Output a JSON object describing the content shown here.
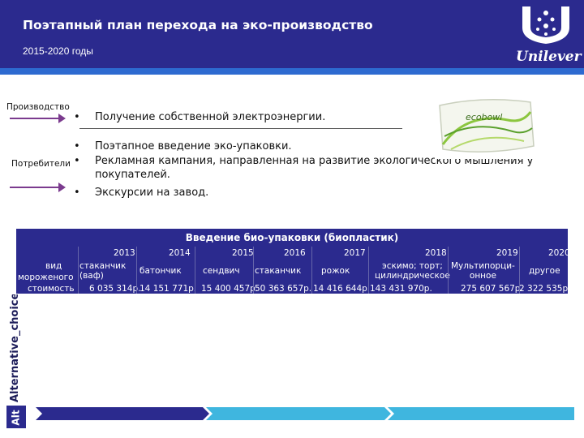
{
  "header": {
    "title": "Поэтапный план перехода на эко-производство",
    "subtitle": "2015-2020 годы",
    "logo_text": "Unilever"
  },
  "left": {
    "production_label": "Производство",
    "consumers_label": "Потребители"
  },
  "bullets": {
    "b1": "Получение собственной электроэнергии.",
    "b2": "Поэтапное введение эко-упаковки.",
    "b3a": "Рекламная кампания, направленная на развитие экологического мышления у",
    "b3b": "покупателей.",
    "b4": "Экскурсии на завод."
  },
  "package": {
    "brand": "ecobowl"
  },
  "table": {
    "title": "Введение био-упаковки (биопластик)",
    "row_labels": {
      "type_a": "вид",
      "type_b": "мороженого",
      "cost": "стоимость"
    },
    "years": [
      "2013",
      "2014",
      "2015",
      "2016",
      "2017",
      "2018",
      "2019",
      "2020"
    ],
    "types": [
      [
        "стаканчик",
        "(ваф)"
      ],
      [
        "батончик",
        ""
      ],
      [
        "сендвич",
        ""
      ],
      [
        "стаканчик",
        ""
      ],
      [
        "рожок",
        ""
      ],
      [
        "эскимо; торт;",
        "цилиндрическое"
      ],
      [
        "Мультипорци-",
        "онное"
      ],
      [
        "другое",
        ""
      ]
    ],
    "costs": [
      "6 035 314р.",
      "14 151 771р.",
      "15 400 457р.",
      "50 363 657р.",
      "14 416 644р.",
      "143 431 970р.",
      "275 607 567р.",
      "2 322 535р."
    ]
  },
  "side_text": "Alternative_choice",
  "side_text_short": "Alt",
  "colors": {
    "primary": "#2b2a8e",
    "accent": "#2d6ad0",
    "arrow": "#7b3b8e",
    "footer_light": "#3fb6df"
  }
}
